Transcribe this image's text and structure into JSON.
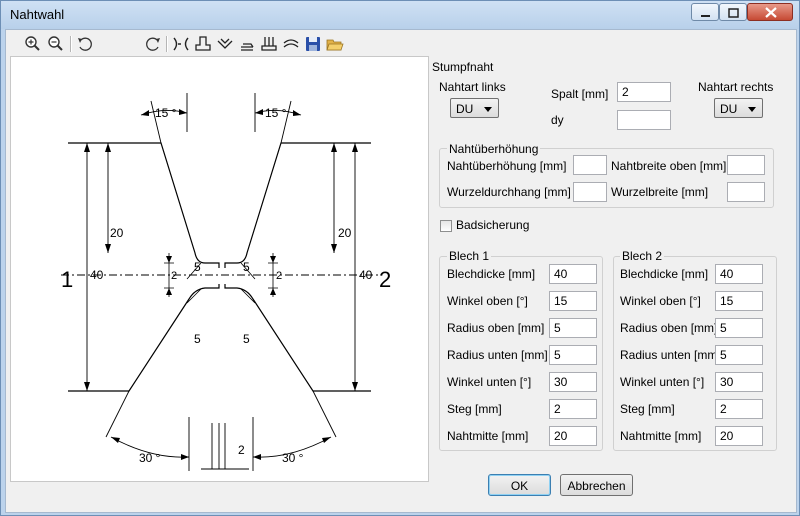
{
  "window": {
    "title": "Nahtwahl"
  },
  "toolbar": {
    "icons": [
      "zoom-in-icon",
      "zoom-out-icon",
      "rotate-left-icon",
      "rotate-right-icon",
      "weld-k-icon",
      "weld-t-icon",
      "weld-v-icon",
      "weld-fillet-icon",
      "weld-stud-icon",
      "weld-arc-icon",
      "save-icon",
      "open-folder-icon"
    ]
  },
  "drawing": {
    "angle_top_left": "15 °",
    "angle_top_right": "15 °",
    "angle_bottom_left": "30 °",
    "angle_bottom_right": "30 °",
    "height_left": "20",
    "height_right": "20",
    "thickness_left": "40",
    "thickness_right": "40",
    "gap_left": "2",
    "gap_right": "2",
    "radius_tl": "5",
    "radius_tr": "5",
    "radius_bl": "5",
    "radius_br": "5",
    "gap_bottom": "2",
    "sheet_left": "1",
    "sheet_right": "2"
  },
  "form": {
    "section_title": "Stumpfnaht",
    "nahtart_links_label": "Nahtart links",
    "nahtart_links_value": "DU",
    "nahtart_rechts_label": "Nahtart rechts",
    "nahtart_rechts_value": "DU",
    "spalt_label": "Spalt [mm]",
    "spalt_value": "2",
    "dy_label": "dy",
    "dy_value": "",
    "ueberhoehung": {
      "title": "Nahtüberhöhung",
      "ueberhoehung_label": "Nahtüberhöhung [mm]",
      "ueberhoehung_value": "",
      "breite_oben_label": "Nahtbreite oben [mm]",
      "breite_oben_value": "",
      "wurzeldurchhang_label": "Wurzeldurchhang [mm]",
      "wurzeldurchhang_value": "",
      "wurzelbreite_label": "Wurzelbreite [mm]",
      "wurzelbreite_value": ""
    },
    "badsicherung_label": "Badsicherung",
    "badsicherung_checked": false,
    "blech1": {
      "title": "Blech 1",
      "rows": [
        {
          "label": "Blechdicke [mm]",
          "value": "40"
        },
        {
          "label": "Winkel oben [°]",
          "value": "15"
        },
        {
          "label": "Radius oben [mm]",
          "value": "5"
        },
        {
          "label": "Radius unten [mm]",
          "value": "5"
        },
        {
          "label": "Winkel unten [°]",
          "value": "30"
        },
        {
          "label": "Steg [mm]",
          "value": "2"
        },
        {
          "label": "Nahtmitte [mm]",
          "value": "20"
        }
      ]
    },
    "blech2": {
      "title": "Blech 2",
      "rows": [
        {
          "label": "Blechdicke [mm]",
          "value": "40"
        },
        {
          "label": "Winkel oben [°]",
          "value": "15"
        },
        {
          "label": "Radius oben [mm]",
          "value": "5"
        },
        {
          "label": "Radius unten [mm]",
          "value": "5"
        },
        {
          "label": "Winkel unten [°]",
          "value": "30"
        },
        {
          "label": "Steg [mm]",
          "value": "2"
        },
        {
          "label": "Nahtmitte [mm]",
          "value": "20"
        }
      ]
    }
  },
  "buttons": {
    "ok": "OK",
    "cancel": "Abbrechen"
  }
}
